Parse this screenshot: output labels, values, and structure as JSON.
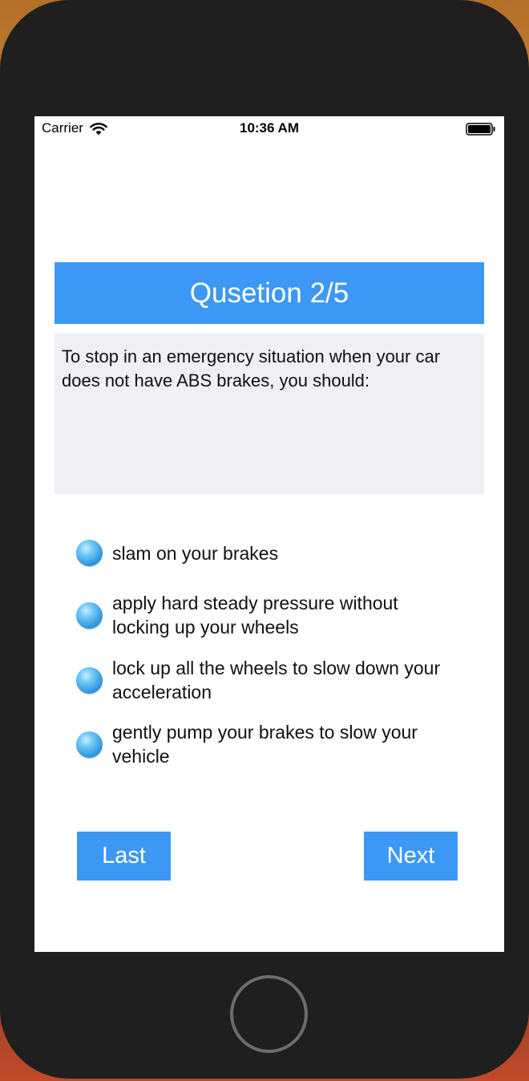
{
  "status_bar": {
    "carrier": "Carrier",
    "time": "10:36 AM"
  },
  "quiz": {
    "title": "Qusetion 2/5",
    "question": "To stop in an emergency situation when your car does not have ABS brakes, you should:",
    "options": [
      {
        "label": "slam on your brakes"
      },
      {
        "label": "apply hard steady pressure without locking up your wheels"
      },
      {
        "label": "lock up all the wheels to slow down your acceleration"
      },
      {
        "label": "gently pump your brakes to slow your vehicle"
      }
    ]
  },
  "buttons": {
    "last_label": "Last",
    "next_label": "Next"
  },
  "colors": {
    "accent": "#3d98f5",
    "question_bg": "#efeff4",
    "device_bezel": "#1f1f1f"
  },
  "icons": {
    "wifi": "wifi-icon",
    "battery": "battery-icon",
    "radio": "radio-icon",
    "home": "home-button"
  }
}
